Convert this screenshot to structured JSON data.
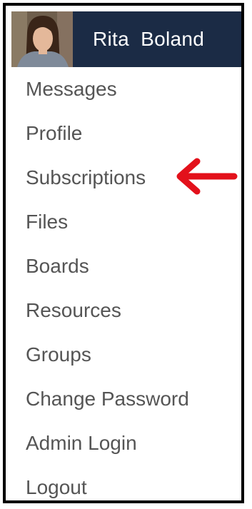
{
  "user": {
    "name": "Rita  Boland"
  },
  "menu": {
    "items": [
      {
        "label": "Messages"
      },
      {
        "label": "Profile"
      },
      {
        "label": "Subscriptions"
      },
      {
        "label": "Files"
      },
      {
        "label": "Boards"
      },
      {
        "label": "Resources"
      },
      {
        "label": "Groups"
      },
      {
        "label": "Change Password"
      },
      {
        "label": "Admin Login"
      },
      {
        "label": "Logout"
      }
    ]
  },
  "annotation": {
    "icon": "arrow-left-icon",
    "color": "#e3111b",
    "points_to": "Subscriptions"
  },
  "colors": {
    "header_background": "#1b2b45",
    "menu_text": "#555555"
  }
}
